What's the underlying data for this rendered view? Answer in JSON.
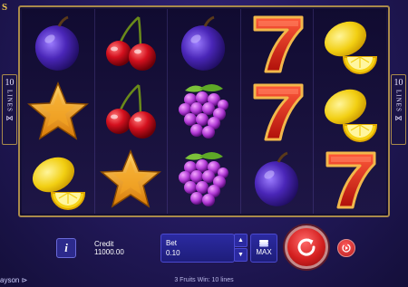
{
  "logo": {
    "fragment": "S"
  },
  "lines_badge": {
    "number": "10",
    "word": "LINES",
    "symbol": "⋈"
  },
  "reels": [
    [
      "plum",
      "star",
      "lemon"
    ],
    [
      "cherry",
      "cherry",
      "star"
    ],
    [
      "plum",
      "grapes",
      "grapes"
    ],
    [
      "seven",
      "seven",
      "plum"
    ],
    [
      "lemon",
      "lemon",
      "seven"
    ]
  ],
  "controls": {
    "info_label": "i",
    "credit_label": "Credit",
    "credit_value": "11000.00",
    "bet_label": "Bet",
    "bet_value": "0.10",
    "bet_up": "▲",
    "bet_down": "▼",
    "max_label": "MAX"
  },
  "footer": {
    "brand": "ayson",
    "status": "3 Fruits Win: 10 lines"
  },
  "colors": {
    "background": "#241a5e",
    "frame_border": "#a98a4b",
    "spin_button": "#d42020",
    "panel": "#2b2aa1"
  }
}
